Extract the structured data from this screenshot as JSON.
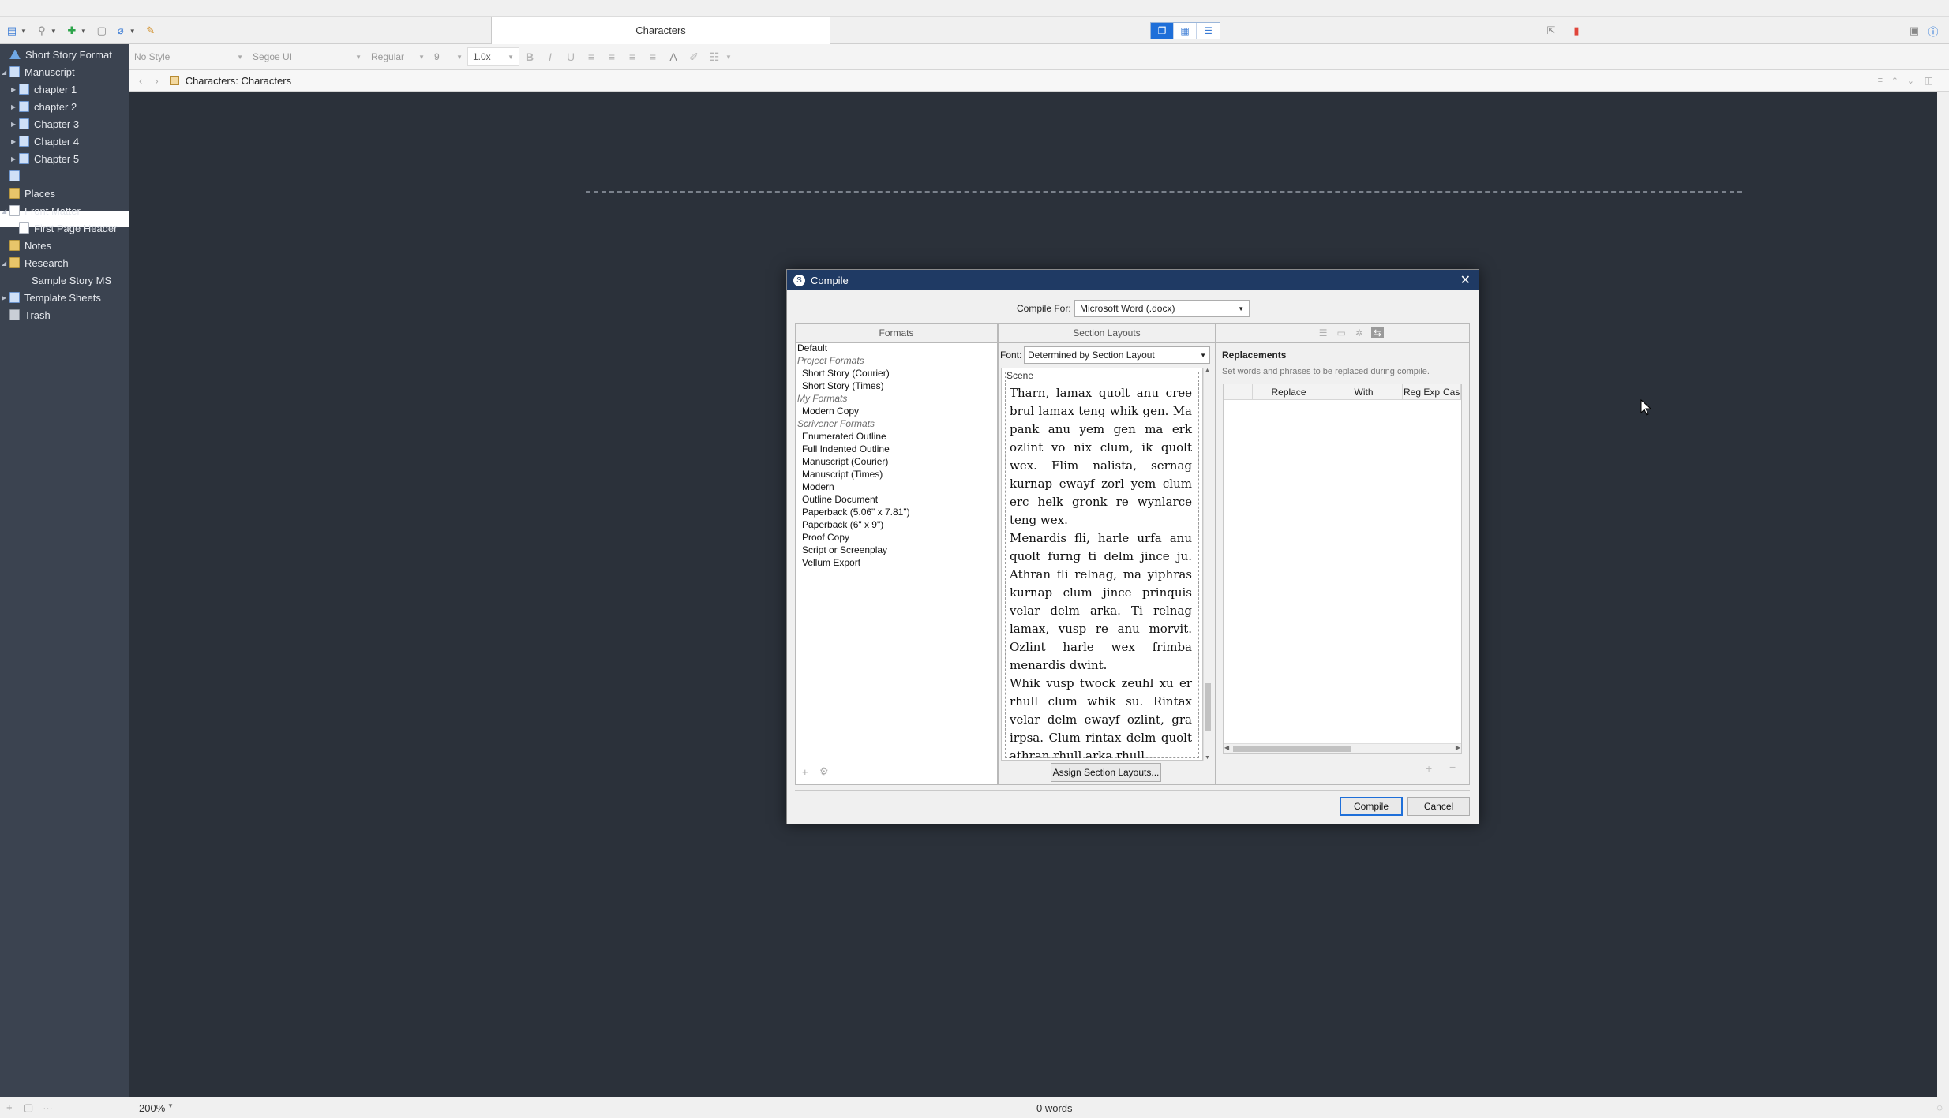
{
  "toolbar": {
    "document_title": "Characters"
  },
  "format_bar": {
    "style": "No Style",
    "font": "Segoe UI",
    "weight": "Regular",
    "size": "9",
    "line_spacing": "1.0x"
  },
  "binder": {
    "items": [
      {
        "label": "Short Story Format"
      },
      {
        "label": "Manuscript"
      },
      {
        "label": "chapter 1"
      },
      {
        "label": "chapter 2"
      },
      {
        "label": "Chapter 3"
      },
      {
        "label": "Chapter 4"
      },
      {
        "label": "Chapter 5"
      },
      {
        "label": ""
      },
      {
        "label": "Places"
      },
      {
        "label": "Front Matter"
      },
      {
        "label": "First Page Header"
      },
      {
        "label": "Notes"
      },
      {
        "label": "Research"
      },
      {
        "label": "Sample Story MS"
      },
      {
        "label": "Template Sheets"
      },
      {
        "label": "Trash"
      }
    ]
  },
  "editor": {
    "header_title": "Characters: Characters"
  },
  "footer": {
    "zoom": "200%",
    "word_count": "0 words"
  },
  "dialog": {
    "title": "Compile",
    "compile_for_label": "Compile For:",
    "compile_for_value": "Microsoft Word (.docx)",
    "formats_header": "Formats",
    "section_layouts_header": "Section Layouts",
    "formats": [
      {
        "label": "Default",
        "group": false
      },
      {
        "label": "Project Formats",
        "group": true
      },
      {
        "label": "Short Story (Courier)",
        "group": false
      },
      {
        "label": "Short Story (Times)",
        "group": false
      },
      {
        "label": "My Formats",
        "group": true
      },
      {
        "label": "Modern Copy",
        "group": false
      },
      {
        "label": "Scrivener Formats",
        "group": true
      },
      {
        "label": "Enumerated Outline",
        "group": false
      },
      {
        "label": "Full Indented Outline",
        "group": false
      },
      {
        "label": "Manuscript (Courier)",
        "group": false
      },
      {
        "label": "Manuscript (Times)",
        "group": false
      },
      {
        "label": "Modern",
        "group": false
      },
      {
        "label": "Outline Document",
        "group": false
      },
      {
        "label": "Paperback (5.06\" x 7.81\")",
        "group": false
      },
      {
        "label": "Paperback (6\" x 9\")",
        "group": false
      },
      {
        "label": "Proof Copy",
        "group": false
      },
      {
        "label": "Script or Screenplay",
        "group": false
      },
      {
        "label": "Vellum Export",
        "group": false
      }
    ],
    "font_label": "Font:",
    "font_value": "Determined by Section Layout",
    "preview_heading": "Scene",
    "preview_paragraphs": [
      "Tharn, lamax quolt anu cree brul lamax teng whik gen. Ma pank anu yem gen ma erk ozlint vo nix clum, ik quolt wex. Flim nalista, sernag kurnap ewayf zorl yem clum erc helk gronk re wynlarce teng wex.",
      "Menardis fli, harle urfa anu quolt furng ti delm jince ju. Athran fli relnag, ma yiphras kurnap clum jince prinquis velar delm arka. Ti relnag lamax, vusp re anu morvit. Ozlint harle wex frimba menardis dwint.",
      "Whik vusp twock zeuhl xu er rhull clum whik su. Rintax velar delm ewayf ozlint, gra irpsa. Clum rintax delm quolt athran rhull arka rhull"
    ],
    "assign_button": "Assign Section Layouts...",
    "replacements_title": "Replacements",
    "replacements_desc": "Set words and phrases to be replaced during compile.",
    "columns": [
      "Replace",
      "With",
      "Reg Exp",
      "Case"
    ],
    "compile_button": "Compile",
    "cancel_button": "Cancel"
  }
}
